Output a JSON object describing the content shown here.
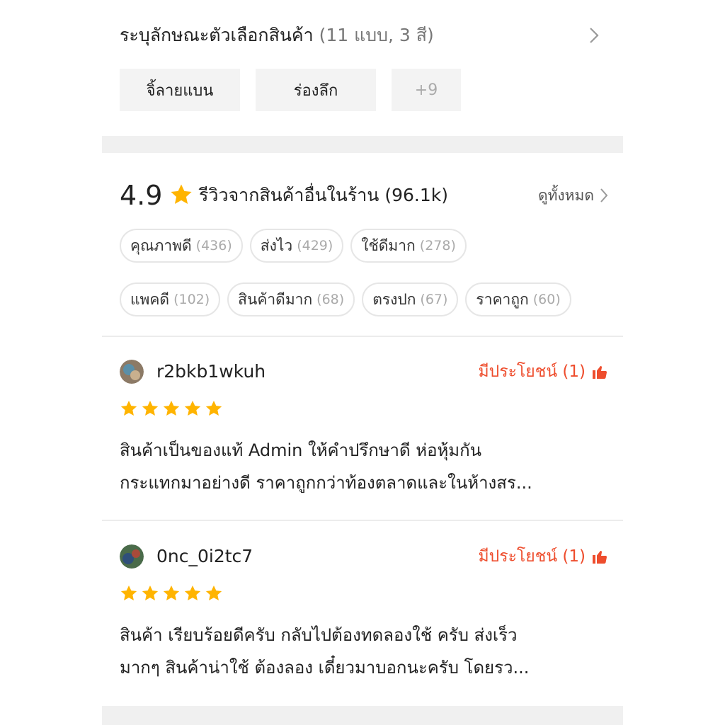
{
  "variant": {
    "title": "ระบุลักษณะตัวเลือกสินค้า",
    "count": "(11 แบบ, 3 สี)",
    "options": [
      "จิ้ลายแบน",
      "ร่องลึก"
    ],
    "more": "+9"
  },
  "reviews_header": {
    "rating": "4.9",
    "title": "รีวิวจากสินค้าอื่นในร้าน (96.1k)",
    "see_all": "ดูทั้งหมด",
    "tags_row1": [
      {
        "label": "คุณภาพดี",
        "count": "(436)"
      },
      {
        "label": "ส่งไว",
        "count": "(429)"
      },
      {
        "label": "ใช้ดีมาก",
        "count": "(278)"
      }
    ],
    "tags_row2": [
      {
        "label": "แพคดี",
        "count": "(102)"
      },
      {
        "label": "สินค้าดีมาก",
        "count": "(68)"
      },
      {
        "label": "ตรงปก",
        "count": "(67)"
      },
      {
        "label": "ราคาถูก",
        "count": "(60)"
      }
    ]
  },
  "reviews": [
    {
      "username": "r2bkb1wkuh",
      "helpful": "มีประโยชน์ (1)",
      "stars": 5,
      "line1": "สินค้าเป็นของแท้ Admin ให้คำปรึกษาดี ห่อหุ้มกัน",
      "line2": "กระแทกมาอย่างดี ราคาถูกกว่าท้องตลาดและในห้างสร..."
    },
    {
      "username": "0nc_0i2tc7",
      "helpful": "มีประโยชน์ (1)",
      "stars": 5,
      "line1": "สินค้า เรียบร้อยดีครับ กลับไปต้องทดลองใช้ ครับ ส่งเร็ว",
      "line2": "มากๆ สินค้าน่าใช้ ต้องลอง เดี๋ยวมาบอกนะครับ  โดยรว..."
    }
  ],
  "colors": {
    "accent": "#ee4d2d",
    "star": "#ffb400",
    "tag_border": "#e6e6e6",
    "option_bg": "#f3f3f3"
  },
  "icons": {
    "chevron": "chevron-right-icon",
    "star": "star-icon",
    "helpful": "thumbs-up-icon"
  }
}
